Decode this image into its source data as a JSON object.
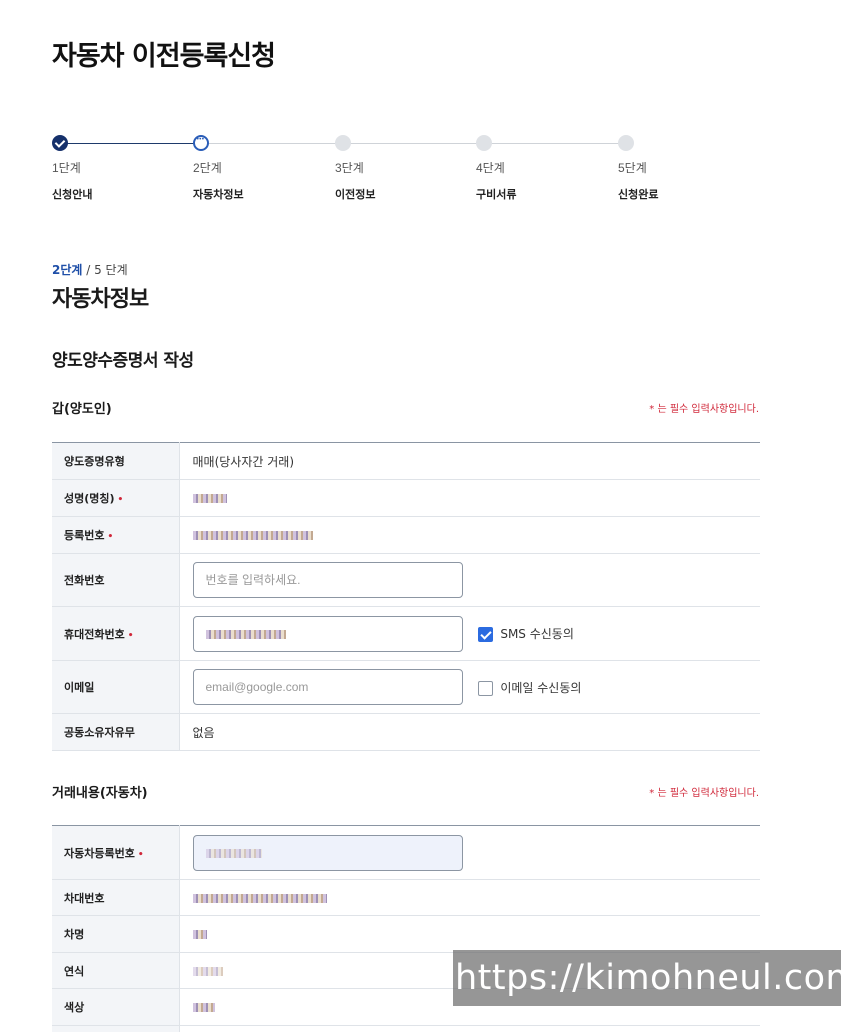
{
  "page_title": "자동차 이전등록신청",
  "stepper": [
    {
      "num": "1단계",
      "name": "신청안내",
      "state": "done"
    },
    {
      "num": "2단계",
      "name": "자동차정보",
      "state": "current"
    },
    {
      "num": "3단계",
      "name": "이전정보",
      "state": "todo"
    },
    {
      "num": "4단계",
      "name": "구비서류",
      "state": "todo"
    },
    {
      "num": "5단계",
      "name": "신청완료",
      "state": "todo"
    }
  ],
  "step_indicator": {
    "current": "2단계",
    "total": " / 5 단계"
  },
  "section_title": "자동차정보",
  "sub_title": "양도양수증명서 작성",
  "required_note": "* 는 필수 입력사항입니다.",
  "required_mark": "•",
  "transferor": {
    "title": "갑(양도인)",
    "rows": {
      "proof_type": {
        "label": "양도증명유형",
        "value": "매매(당사자간 거래)"
      },
      "name": {
        "label": "성명(명칭)"
      },
      "reg_no": {
        "label": "등록번호"
      },
      "phone": {
        "label": "전화번호",
        "placeholder": "번호를 입력하세요."
      },
      "mobile": {
        "label": "휴대전화번호",
        "sms_consent": "SMS 수신동의"
      },
      "email": {
        "label": "이메일",
        "placeholder": "email@google.com",
        "email_consent": "이메일 수신동의"
      },
      "co_owner": {
        "label": "공동소유자유무",
        "value": "없음"
      }
    }
  },
  "deal": {
    "title": "거래내용(자동차)",
    "rows": {
      "car_reg_no": {
        "label": "자동차등록번호"
      },
      "vin": {
        "label": "차대번호"
      },
      "car_name": {
        "label": "차명"
      },
      "model_year": {
        "label": "연식"
      },
      "color": {
        "label": "색상"
      }
    }
  },
  "colors": {
    "accent": "#2b6be0",
    "done_step": "#15306b",
    "required": "#d0283a"
  },
  "watermark": "https://kimohneul.com"
}
